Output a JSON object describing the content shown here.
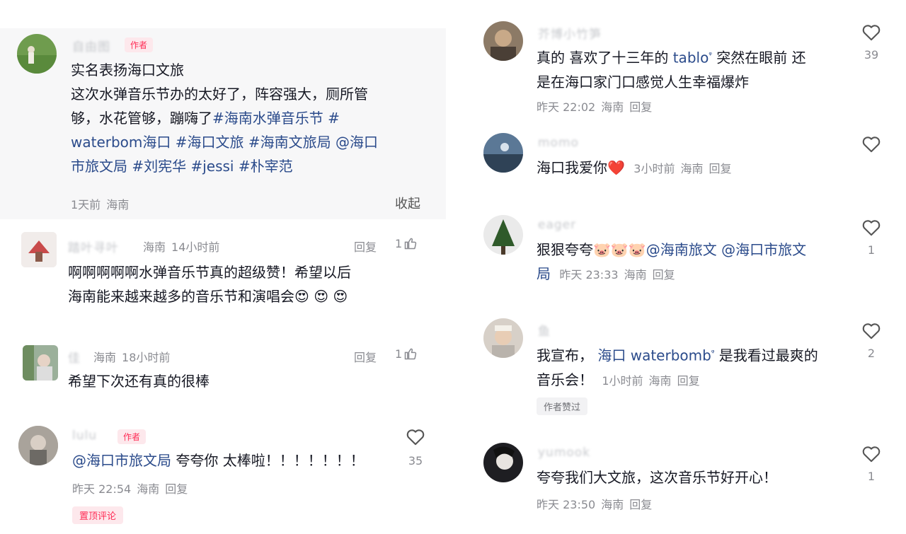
{
  "left": {
    "c1": {
      "name": "自由图",
      "author_tag": "作者",
      "lines": [
        "实名表扬海口文旅",
        "这次水弹音乐节办的太好了，阵容强大，厕所管",
        "够，水花管够，蹦嗨了",
        "#海南水弹音乐节 #",
        "waterbom海口 #海口文旅 #海南文旅局 @海口",
        "市旅文局 #刘宪华 #jessi #朴宰范"
      ],
      "time": "1天前",
      "location": "海南",
      "collapse": "收起"
    },
    "c2": {
      "name": "踏叶寻叶",
      "location": "海南",
      "time": "14小时前",
      "reply": "回复",
      "likes": "1",
      "line1": "啊啊啊啊啊水弹音乐节真的超级赞！希望以后",
      "line2": "海南能来越来越多的音乐节和演唱会",
      "emojis": "😍 😍 😍"
    },
    "c3": {
      "name": "佳",
      "location": "海南",
      "time": "18小时前",
      "reply": "回复",
      "likes": "1",
      "line1": "希望下次还有真的很棒"
    },
    "c4": {
      "name": "lulu",
      "author_tag": "作者",
      "mention": "@海口市旅文局",
      "line1": " 夸夸你 太棒啦！！！！！！！",
      "time": "昨天 22:54",
      "location": "海南",
      "reply": "回复",
      "likes": "35",
      "pinned": "置顶评论"
    }
  },
  "right": {
    "r1": {
      "name": "芥博小竹笋",
      "line1a": "真的 喜欢了十三年的 ",
      "line1link": "tablo",
      "line1b": " 突然在眼前 还",
      "line2": "是在海口家门口感觉人生幸福爆炸",
      "time": "昨天 22:02",
      "location": "海南",
      "reply": "回复",
      "likes": "39"
    },
    "r2": {
      "name": "momo",
      "line1": "海口我爱你",
      "emoji": "❤️",
      "time": "3小时前",
      "location": "海南",
      "reply": "回复"
    },
    "r3": {
      "name": "eager",
      "line1a": "狠狠夸夸",
      "emojis": "🐷🐷🐷",
      "mention1": "@海南旅文",
      "mention2": " @海口市旅文",
      "line2link": "局",
      "time": "昨天 23:33",
      "location": "海南",
      "reply": "回复",
      "likes": "1"
    },
    "r4": {
      "name": "鱼",
      "line1a": "我宣布，",
      "line1link": "海口 waterbomb",
      "line1b": " 是我看过最爽的",
      "line2": "音乐会！",
      "time": "1小时前",
      "location": "海南",
      "reply": "回复",
      "likes": "2",
      "badge": "作者赞过"
    },
    "r5": {
      "name": "yumook",
      "line1": "夸夸我们大文旅，这次音乐节好开心！",
      "time": "昨天 23:50",
      "location": "海南",
      "reply": "回复",
      "likes": "1"
    }
  }
}
